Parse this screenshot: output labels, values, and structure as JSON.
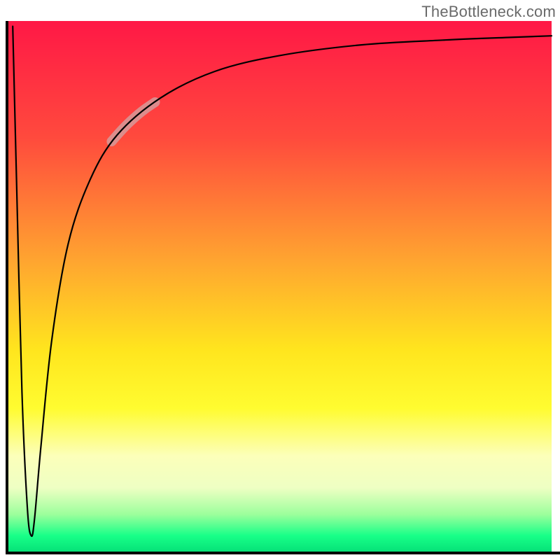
{
  "watermark": {
    "text": "TheBottleneck.com"
  },
  "chart_data": {
    "type": "line",
    "title": "",
    "xlabel": "",
    "ylabel": "",
    "xlim": [
      0,
      100
    ],
    "ylim": [
      0,
      100
    ],
    "grid": false,
    "legend": null,
    "background_gradient_stops": [
      {
        "pct": 0,
        "color": "#ff1846"
      },
      {
        "pct": 22,
        "color": "#ff4a3d"
      },
      {
        "pct": 45,
        "color": "#ffa430"
      },
      {
        "pct": 62,
        "color": "#ffe51e"
      },
      {
        "pct": 73,
        "color": "#fffc30"
      },
      {
        "pct": 82,
        "color": "#fcffba"
      },
      {
        "pct": 88,
        "color": "#eeffc3"
      },
      {
        "pct": 93,
        "color": "#9cff9c"
      },
      {
        "pct": 97,
        "color": "#18ff88"
      },
      {
        "pct": 100,
        "color": "#06e278"
      }
    ],
    "series": [
      {
        "name": "bottleneck-curve",
        "color": "#000000",
        "width": 2.2,
        "points": [
          {
            "x": 0.8,
            "y": 99.0
          },
          {
            "x": 1.5,
            "y": 70.0
          },
          {
            "x": 2.5,
            "y": 30.0
          },
          {
            "x": 3.5,
            "y": 8.0
          },
          {
            "x": 4.2,
            "y": 3.0
          },
          {
            "x": 4.8,
            "y": 6.0
          },
          {
            "x": 6.0,
            "y": 20.0
          },
          {
            "x": 8.0,
            "y": 40.0
          },
          {
            "x": 11.0,
            "y": 58.0
          },
          {
            "x": 15.0,
            "y": 70.0
          },
          {
            "x": 20.0,
            "y": 78.5
          },
          {
            "x": 28.0,
            "y": 85.5
          },
          {
            "x": 38.0,
            "y": 90.5
          },
          {
            "x": 50.0,
            "y": 93.5
          },
          {
            "x": 65.0,
            "y": 95.5
          },
          {
            "x": 80.0,
            "y": 96.4
          },
          {
            "x": 92.0,
            "y": 96.9
          },
          {
            "x": 100.0,
            "y": 97.2
          }
        ]
      },
      {
        "name": "highlight-segment",
        "color": "#d69a9a",
        "opacity": 0.85,
        "width": 14,
        "points": [
          {
            "x": 19.0,
            "y": 77.3
          },
          {
            "x": 21.0,
            "y": 79.6
          },
          {
            "x": 23.0,
            "y": 81.6
          },
          {
            "x": 25.0,
            "y": 83.3
          },
          {
            "x": 27.0,
            "y": 84.7
          }
        ]
      }
    ]
  }
}
